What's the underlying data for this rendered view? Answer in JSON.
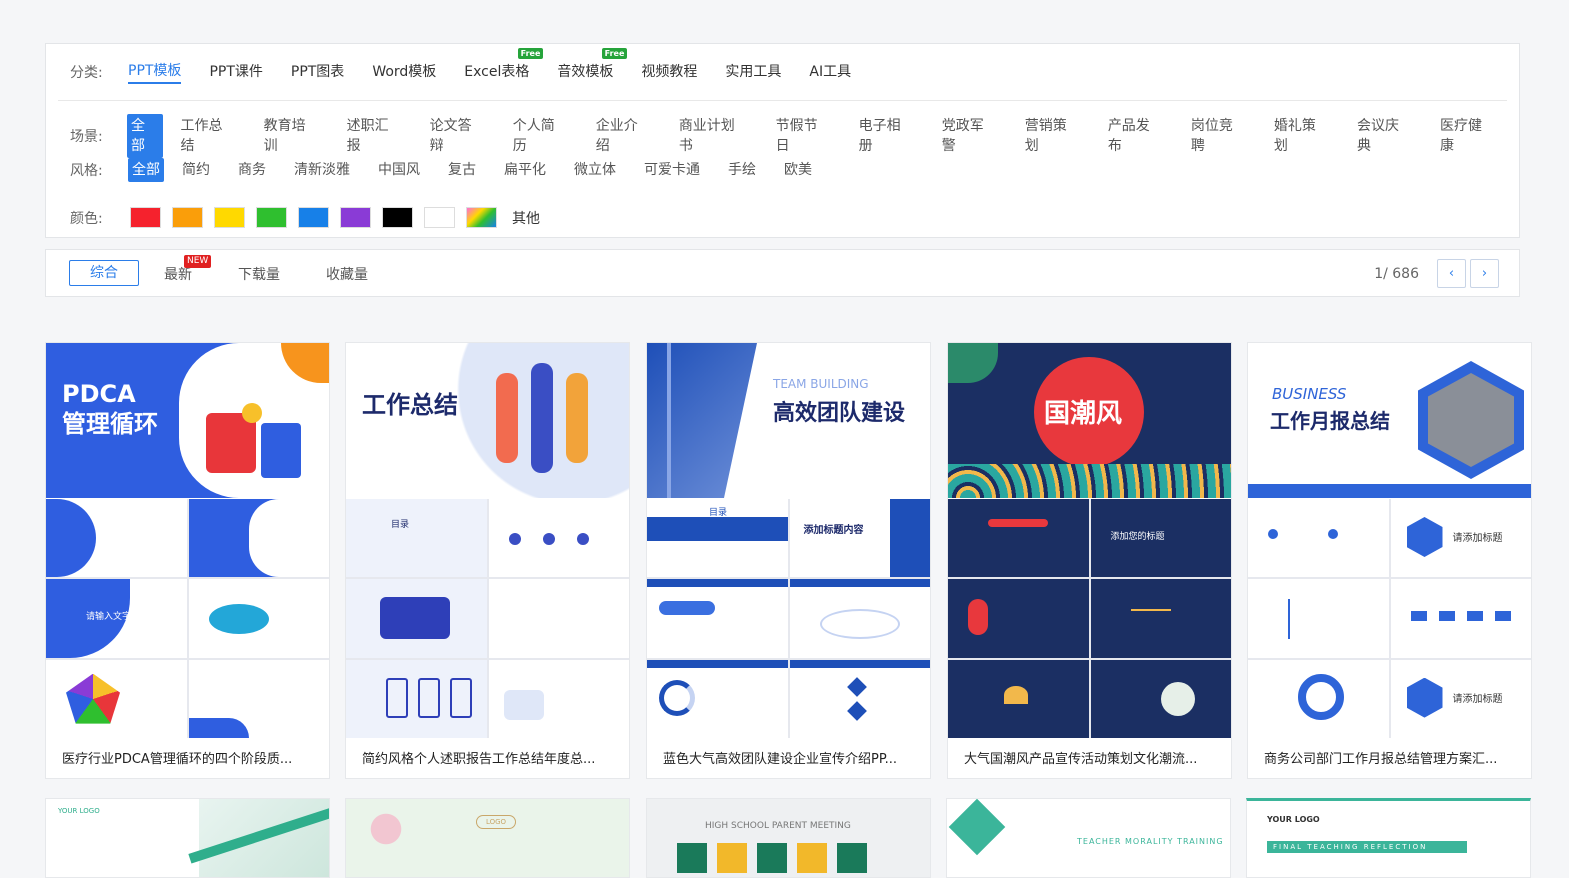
{
  "filters": {
    "category_label": "分类:",
    "categories": [
      {
        "label": "PPT模板",
        "active": true,
        "free": false
      },
      {
        "label": "PPT课件",
        "active": false,
        "free": false
      },
      {
        "label": "PPT图表",
        "active": false,
        "free": false
      },
      {
        "label": "Word模板",
        "active": false,
        "free": false
      },
      {
        "label": "Excel表格",
        "active": false,
        "free": true
      },
      {
        "label": "音效模板",
        "active": false,
        "free": true
      },
      {
        "label": "视频教程",
        "active": false,
        "free": false
      },
      {
        "label": "实用工具",
        "active": false,
        "free": false
      },
      {
        "label": "AI工具",
        "active": false,
        "free": false
      }
    ],
    "free_badge": "Free",
    "scene_label": "场景:",
    "scenes": [
      "全部",
      "工作总结",
      "教育培训",
      "述职汇报",
      "论文答辩",
      "个人简历",
      "企业介绍",
      "商业计划书",
      "节假节日",
      "电子相册",
      "党政军警",
      "营销策划",
      "产品发布",
      "岗位竞聘",
      "婚礼策划",
      "会议庆典",
      "医疗健康"
    ],
    "style_label": "风格:",
    "styles": [
      "全部",
      "简约",
      "商务",
      "清新淡雅",
      "中国风",
      "复古",
      "扁平化",
      "微立体",
      "可爱卡通",
      "手绘",
      "欧美"
    ],
    "color_label": "颜色:",
    "colors": [
      "#f5222d",
      "#fa9e0a",
      "#ffd900",
      "#2fbf2f",
      "#1780e8",
      "#8a3bd6",
      "#000000",
      "#ffffff",
      "gradient"
    ],
    "color_other": "其他"
  },
  "sort": {
    "options": [
      "综合",
      "最新",
      "下载量",
      "收藏量"
    ],
    "new_badge": "NEW",
    "page_current": "1",
    "page_total": "686",
    "page_text": "1/ 686",
    "prev_icon": "‹",
    "next_icon": "›"
  },
  "cards": [
    {
      "title": "医疗行业PDCA管理循环的四个阶段质...",
      "cover_text": "PDCA\n管理循环",
      "theme": "#2f5ee0"
    },
    {
      "title": "简约风格个人述职报告工作总结年度总...",
      "cover_text": "工作总结",
      "theme": "#dfe7f8"
    },
    {
      "title": "蓝色大气高效团队建设企业宣传介绍PP...",
      "cover_text": "高效团队建设",
      "theme": "#1e4fb8"
    },
    {
      "title": "大气国潮风产品宣传活动策划文化潮流...",
      "cover_text": "国潮风",
      "theme": "#1b2f63"
    },
    {
      "title": "商务公司部门工作月报总结管理方案汇...",
      "cover_text": "工作月报总结",
      "theme": "#2e64d8"
    }
  ],
  "cover_extras": {
    "team_building": "TEAM BUILDING",
    "business": "BUSINESS",
    "slide_label_1": "目录",
    "slide_label_2": "添加标题内容",
    "slide_label_3": "请输入文字内容",
    "slide_label_4": "请添加标题",
    "slide_label_5": "添加您的标题"
  },
  "second_row_texts": [
    "YOUR LOGO",
    "LOGO",
    "HIGH SCHOOL PARENT MEETING",
    "TEACHER MORALITY TRAINING",
    "FINAL TEACHING REFLECTION"
  ]
}
